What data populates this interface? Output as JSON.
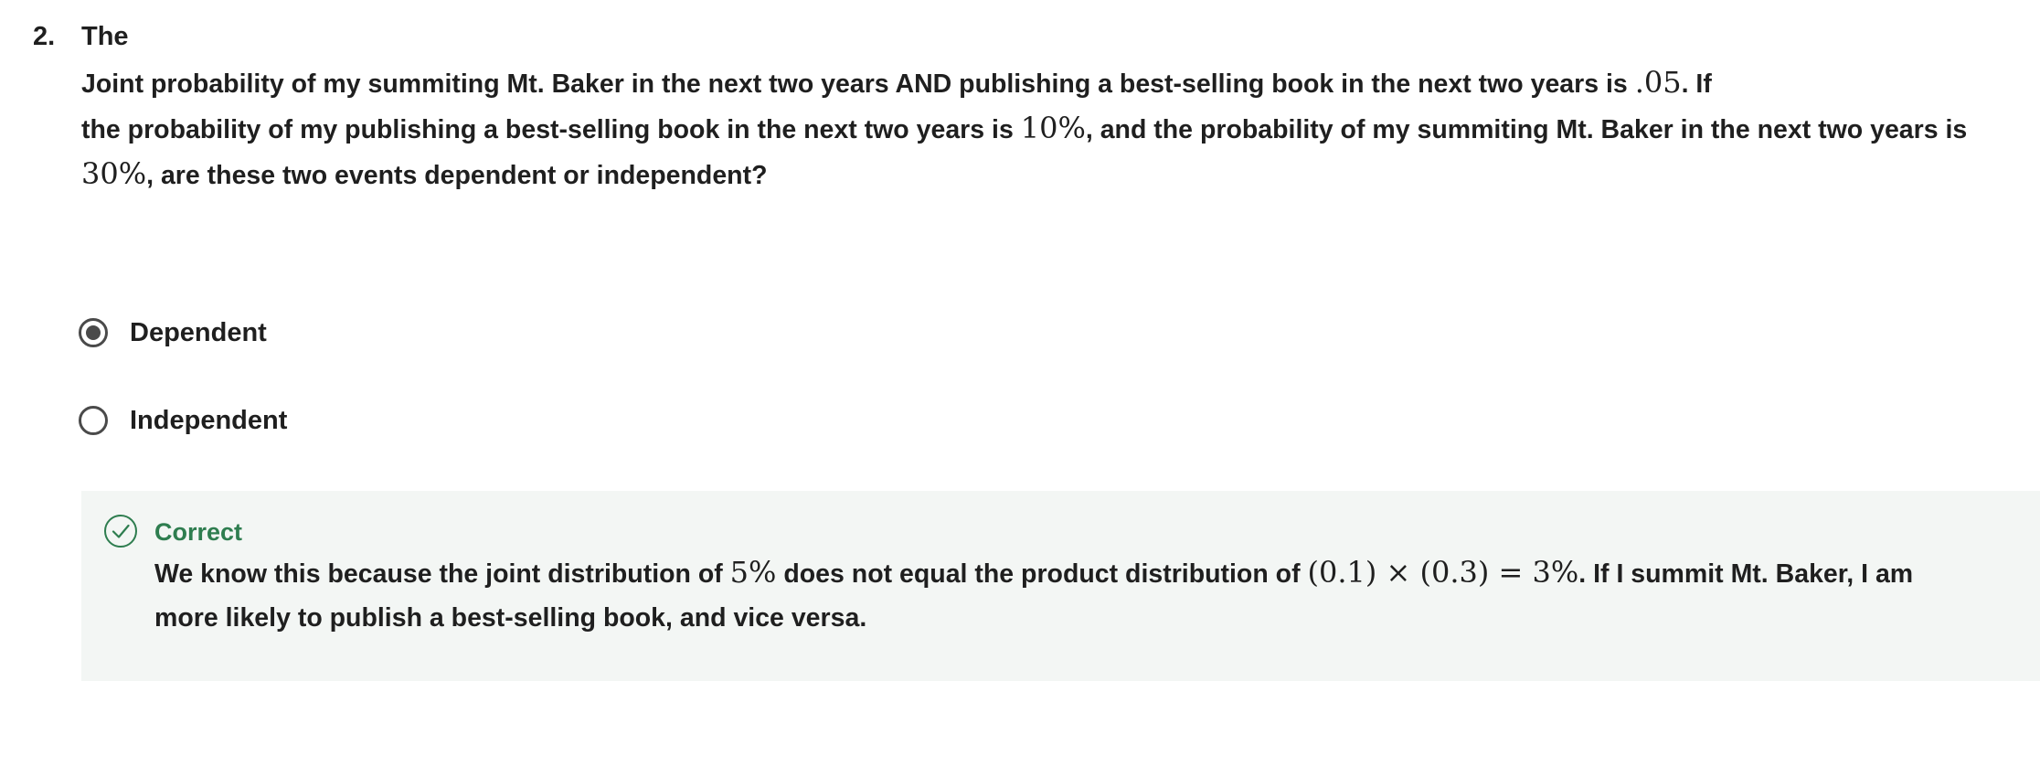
{
  "question": {
    "number": "2.",
    "title": "The",
    "line1_text": "Joint probability of my summiting Mt. Baker in the next two years AND publishing a best-selling book in the next two years is ",
    "line1_math": ".05",
    "line1_end": ". If",
    "line2_text": "the probability of my publishing a best-selling book in the next two years is ",
    "line2_math": "10%",
    "line2_end": ", and the probability of my summiting Mt. Baker in the next two years is",
    "line3_math": "30%",
    "line3_end": ", are these two events dependent or independent?"
  },
  "options": [
    {
      "label": "Dependent",
      "selected": true
    },
    {
      "label": "Independent",
      "selected": false
    }
  ],
  "feedback": {
    "status": "Correct",
    "status_color": "#2e7d4f",
    "background": "#f3f6f4",
    "icon": "check-circle-icon",
    "line1_a": "We know this because the joint distribution of ",
    "line1_math1": "5%",
    "line1_b": " does not equal the product distribution of ",
    "line1_math2": "(0.1) × (0.3) = 3%",
    "line1_c": ". If I summit Mt. Baker, I am",
    "line2": "more likely to publish a best-selling book, and vice versa."
  }
}
